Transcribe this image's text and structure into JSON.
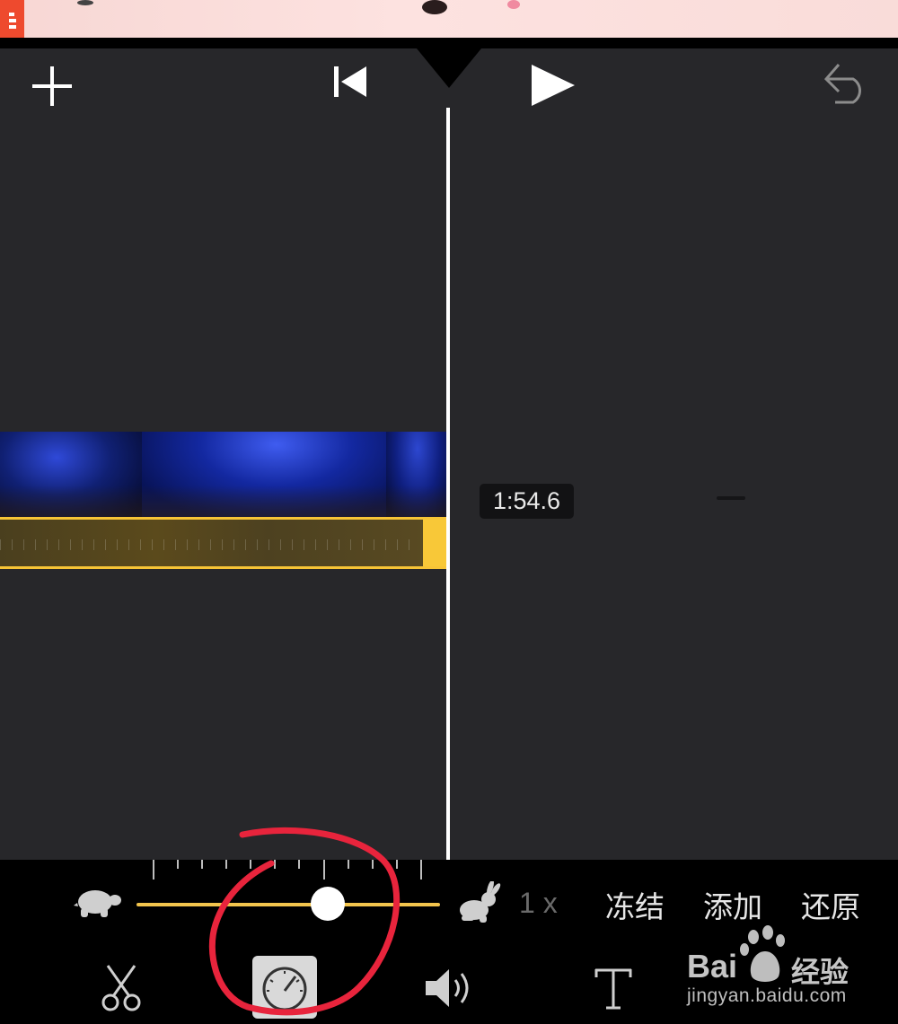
{
  "timeline": {
    "timecode": "1:54.6"
  },
  "speed": {
    "value_label": "1 x",
    "level": 0.63
  },
  "actions": {
    "freeze": "冻结",
    "add": "添加",
    "reset": "还原"
  },
  "toolbar": {
    "active_tool": "speed",
    "icons": [
      "scissors-icon",
      "speedometer-icon",
      "volume-icon",
      "text-icon"
    ]
  },
  "header_icons": [
    "add-icon",
    "rewind-to-start-icon",
    "play-icon",
    "undo-icon"
  ],
  "watermark": {
    "brand_prefix": "Bai",
    "brand_suffix": "经验",
    "url": "jingyan.baidu.com"
  },
  "colors": {
    "editor_background": "#27272a",
    "clip_selection": "#f7c436",
    "slider_track": "#f2c44d",
    "annotation": "#e8243c"
  }
}
